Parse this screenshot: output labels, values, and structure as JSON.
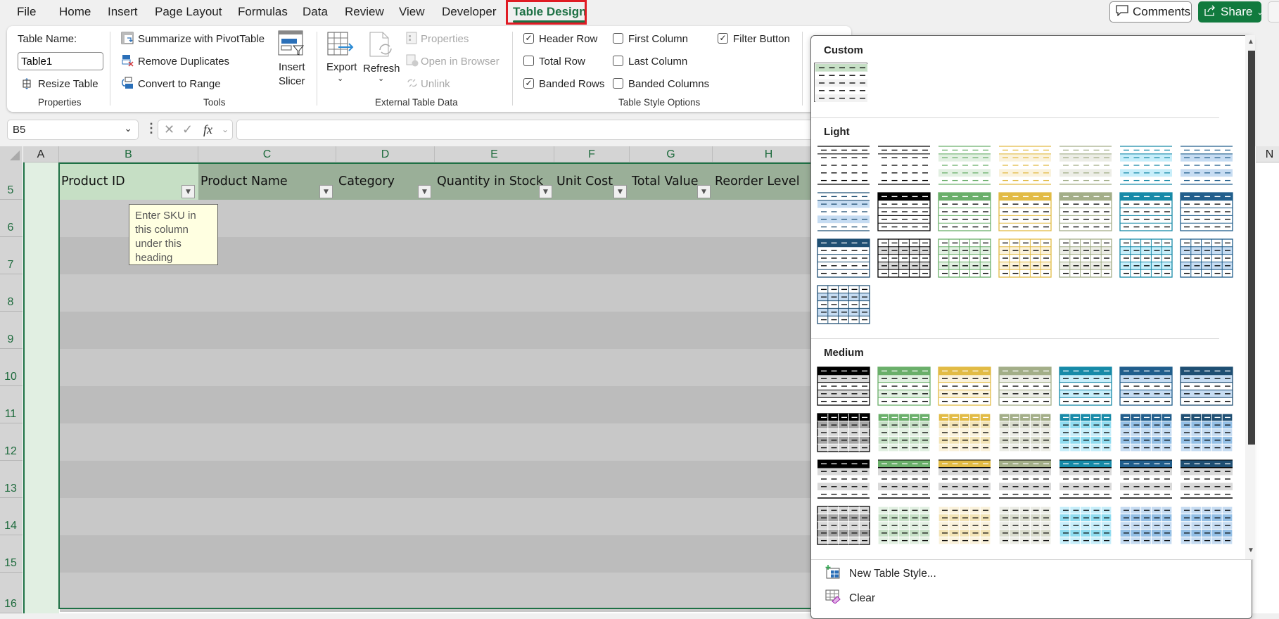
{
  "tabs": [
    {
      "label": "File"
    },
    {
      "label": "Home"
    },
    {
      "label": "Insert"
    },
    {
      "label": "Page Layout"
    },
    {
      "label": "Formulas"
    },
    {
      "label": "Data"
    },
    {
      "label": "Review"
    },
    {
      "label": "View"
    },
    {
      "label": "Developer"
    },
    {
      "label": "Table Design",
      "active": true
    }
  ],
  "topbar": {
    "comments_label": "Comments",
    "share_label": "Share"
  },
  "ribbon": {
    "properties": {
      "table_name_label": "Table Name:",
      "table_name_value": "Table1",
      "resize_label": "Resize Table",
      "group_label": "Properties"
    },
    "tools": {
      "pivot_label": "Summarize with PivotTable",
      "dupes_label": "Remove Duplicates",
      "convert_label": "Convert to Range",
      "slicer_label_1": "Insert",
      "slicer_label_2": "Slicer",
      "group_label": "Tools"
    },
    "external": {
      "export_label": "Export",
      "refresh_label": "Refresh",
      "properties_label": "Properties",
      "open_browser_label": "Open in Browser",
      "unlink_label": "Unlink",
      "group_label": "External Table Data"
    },
    "style_options": {
      "header_row": {
        "label": "Header Row",
        "checked": true
      },
      "total_row": {
        "label": "Total Row",
        "checked": false
      },
      "banded_rows": {
        "label": "Banded Rows",
        "checked": true
      },
      "first_column": {
        "label": "First Column",
        "checked": false
      },
      "last_column": {
        "label": "Last Column",
        "checked": false
      },
      "banded_columns": {
        "label": "Banded Columns",
        "checked": false
      },
      "filter_button": {
        "label": "Filter Button",
        "checked": true
      },
      "group_label": "Table Style Options"
    }
  },
  "formula_bar": {
    "name_box": "B5",
    "formula": "",
    "fx_label": "fx"
  },
  "grid": {
    "columns": [
      "A",
      "B",
      "C",
      "D",
      "E",
      "F",
      "G",
      "H",
      "N"
    ],
    "rows": [
      "5",
      "6",
      "7",
      "8",
      "9",
      "10",
      "11",
      "12",
      "13",
      "14",
      "15",
      "16"
    ],
    "table_headers": [
      "Product ID",
      "Product Name",
      "Category",
      "Quantity in Stock",
      "Unit Cost",
      "Total Value",
      "Reorder Level"
    ],
    "tooltip": "Enter SKU in this column under this heading"
  },
  "gallery": {
    "sections": {
      "custom": "Custom",
      "light": "Light",
      "medium": "Medium"
    },
    "new_style_label": "New Table Style...",
    "clear_label": "Clear"
  },
  "colors": {
    "accent_green": "#1e7145",
    "header_fill": "#9aaf98",
    "selected_header_fill": "#c6dfc5",
    "tooltip_bg": "#ffffe1",
    "highlight_red": "#e01b24"
  }
}
